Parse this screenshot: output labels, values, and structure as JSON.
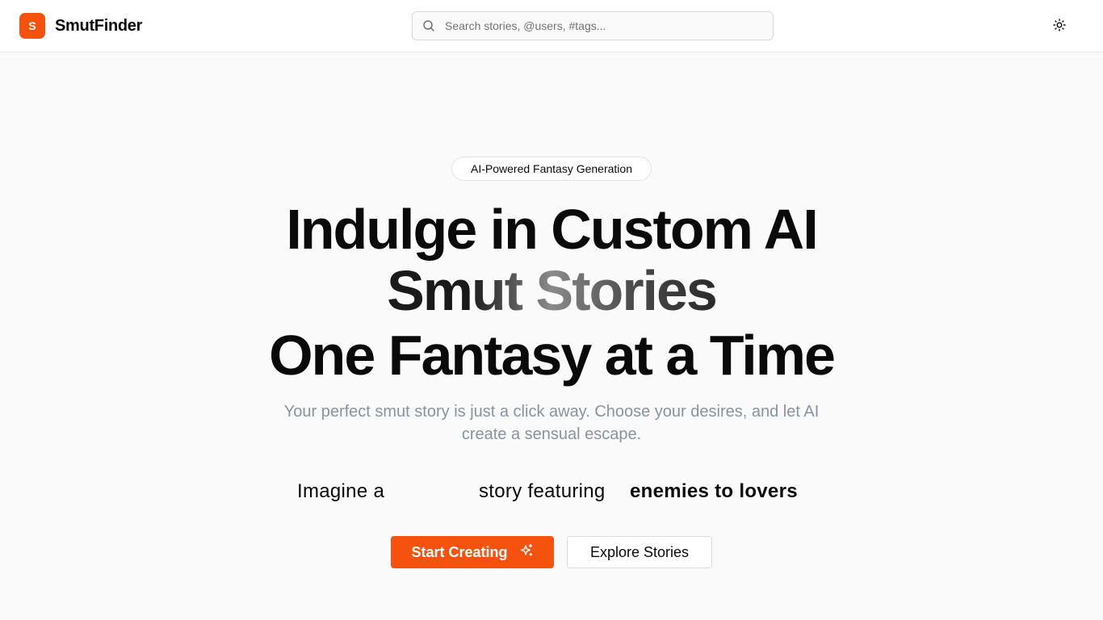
{
  "header": {
    "logo_letter": "S",
    "brand_name": "SmutFinder",
    "search_placeholder": "Search stories, @users, #tags...",
    "search_icon": "search-icon",
    "theme_icon": "sun-icon"
  },
  "hero": {
    "badge": "AI-Powered Fantasy Generation",
    "headline_line1": "Indulge in Custom AI",
    "headline_line2": "Smut Stories",
    "headline_line3": "One Fantasy at a Time",
    "subtitle": "Your perfect smut story is just a click away. Choose your desires, and let AI create a sensual escape.",
    "imagine_prefix": "Imagine a",
    "imagine_middle": "story featuring",
    "imagine_trope": "enemies to lovers"
  },
  "actions": {
    "primary_label": "Start Creating",
    "primary_icon": "sparkles-icon",
    "secondary_label": "Explore Stories"
  },
  "colors": {
    "accent": "#f4520d",
    "text": "#0a0a0a",
    "muted": "#8b929e",
    "background": "#fafafa"
  }
}
